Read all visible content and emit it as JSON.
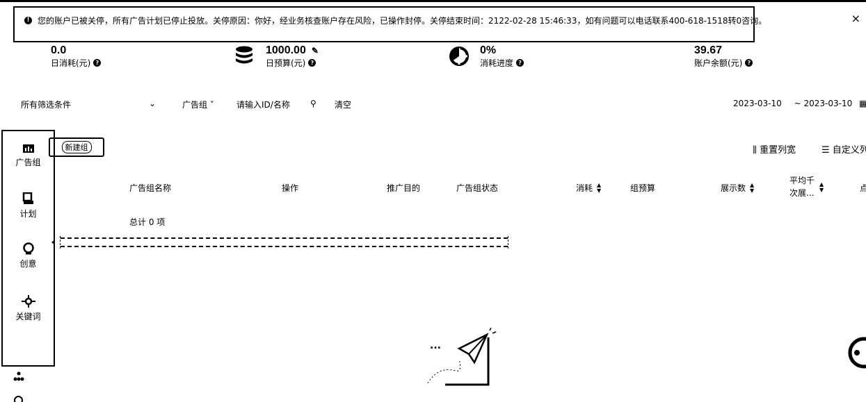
{
  "notice": {
    "text": "您的账户已被关停，所有广告计划已停止投放。关停原因：你好，经业务核查账户存在风险，已操作封停。关停结束时间：2122-02-28 15:46:33，如有问题可以电话联系400-618-1518转0咨询。",
    "close": "×"
  },
  "stats": [
    {
      "value": "0.0",
      "label": "日消耗(元)"
    },
    {
      "value": "1000.00",
      "label": "日预算(元)"
    },
    {
      "value": "0%",
      "label": "消耗进度"
    },
    {
      "value": "39.67",
      "label": "账户余额(元)"
    }
  ],
  "filters": {
    "all_conditions": "所有筛选条件",
    "group_dropdown": "广告组",
    "search_placeholder": "请输入ID/名称",
    "clear": "清空",
    "date_start": "2023-03-10",
    "date_sep": "~",
    "date_end": "2023-03-10"
  },
  "sidebar": {
    "items": [
      {
        "label": "广告组",
        "icon": "bar-chart-icon"
      },
      {
        "label": "计划",
        "icon": "plan-icon"
      },
      {
        "label": "创意",
        "icon": "bulb-icon"
      },
      {
        "label": "关键词",
        "icon": "target-icon"
      }
    ]
  },
  "toolbar": {
    "new_group": "新建组",
    "reset_columns": "重置列宽",
    "custom_columns": "自定义列"
  },
  "table": {
    "columns": [
      "广告组名称",
      "操作",
      "推广目的",
      "广告组状态",
      "消耗",
      "组预算",
      "展示数",
      "平均千次展..."
    ],
    "total": "总计 0 项"
  },
  "empty": {
    "dots": "..."
  }
}
